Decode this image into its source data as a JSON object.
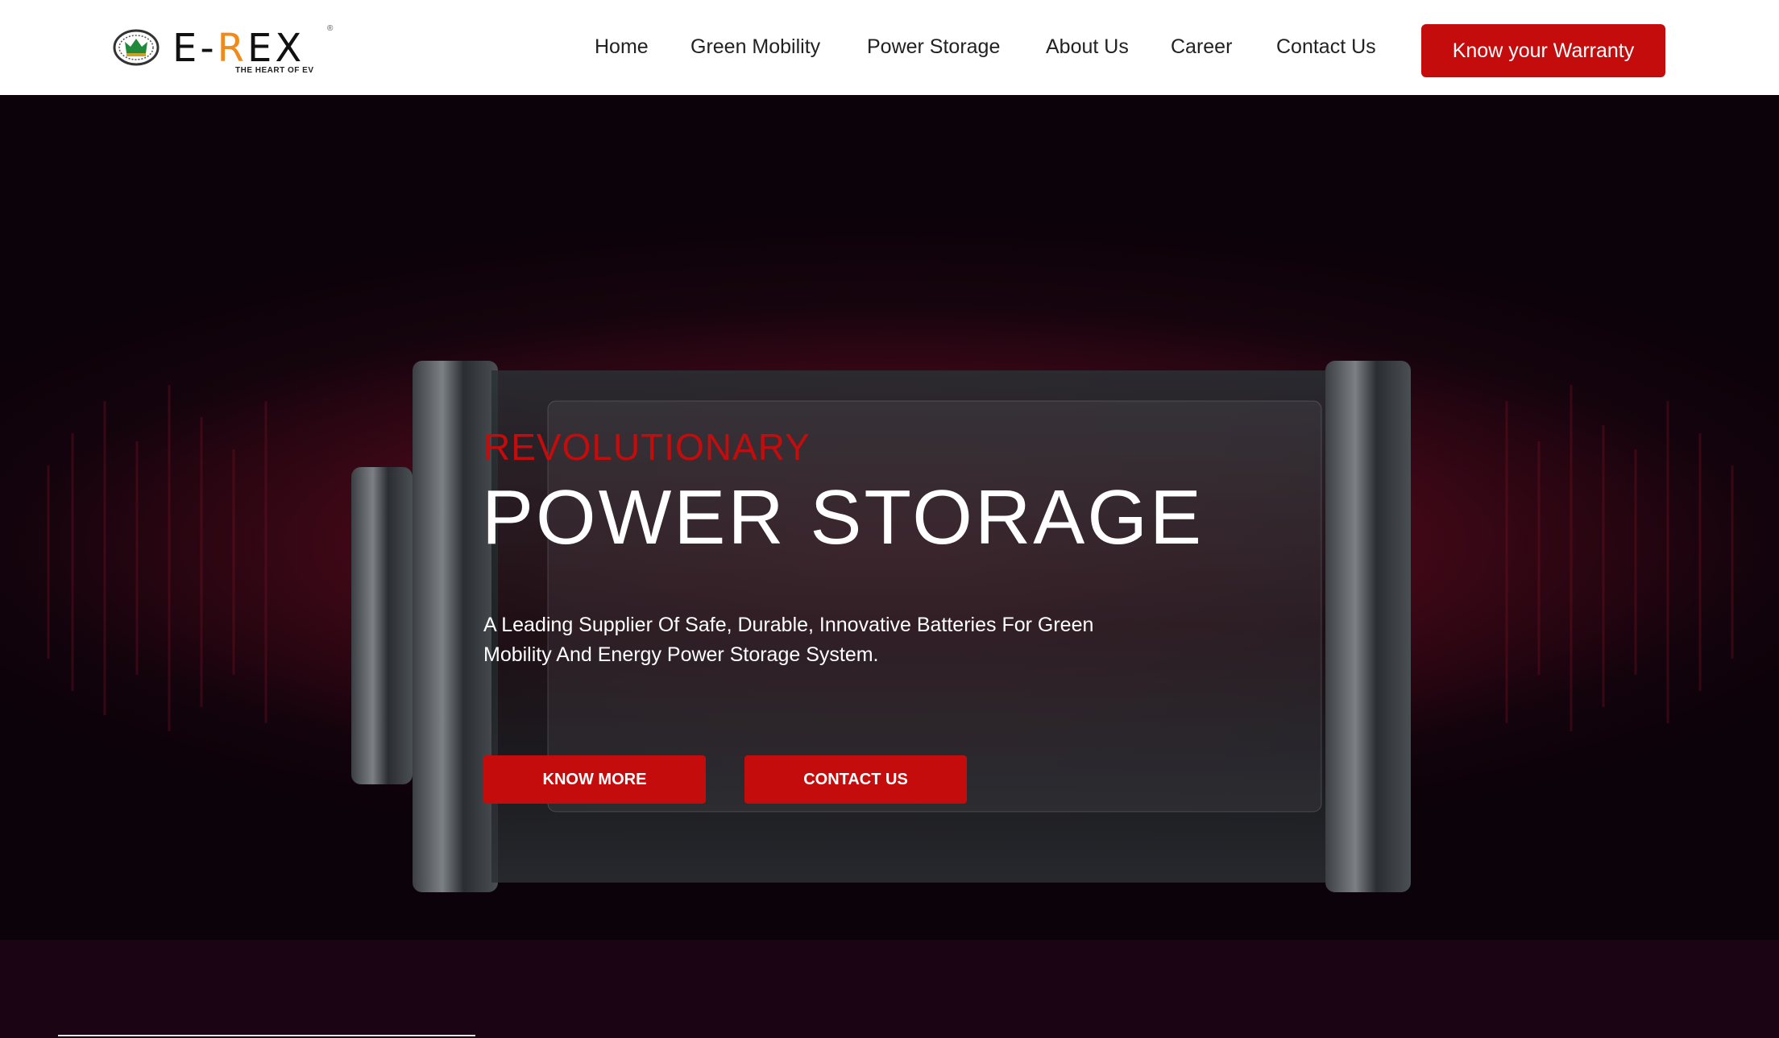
{
  "brand": {
    "name_left": "E-",
    "name_r": "R",
    "name_right": "EX",
    "tagline": "THE HEART OF EV",
    "reg_mark": "®",
    "accent": "#f08a1c"
  },
  "nav": {
    "items": [
      {
        "label": "Home"
      },
      {
        "label": "Green Mobility"
      },
      {
        "label": "Power Storage"
      },
      {
        "label": "About Us"
      },
      {
        "label": "Career"
      },
      {
        "label": "Contact Us"
      }
    ],
    "cta_label": "Know your Warranty"
  },
  "hero": {
    "eyebrow": "REVOLUTIONARY",
    "title": "POWER STORAGE",
    "description": "A Leading Supplier Of Safe, Durable, Innovative Batteries For Green Mobility And Energy Power Storage System.",
    "primary_button": "KNOW MORE",
    "secondary_button": "CONTACT US"
  },
  "colors": {
    "brand_red": "#c40c0c",
    "hero_dark": "#0c0209",
    "glow_red": "#8a0a1c"
  }
}
